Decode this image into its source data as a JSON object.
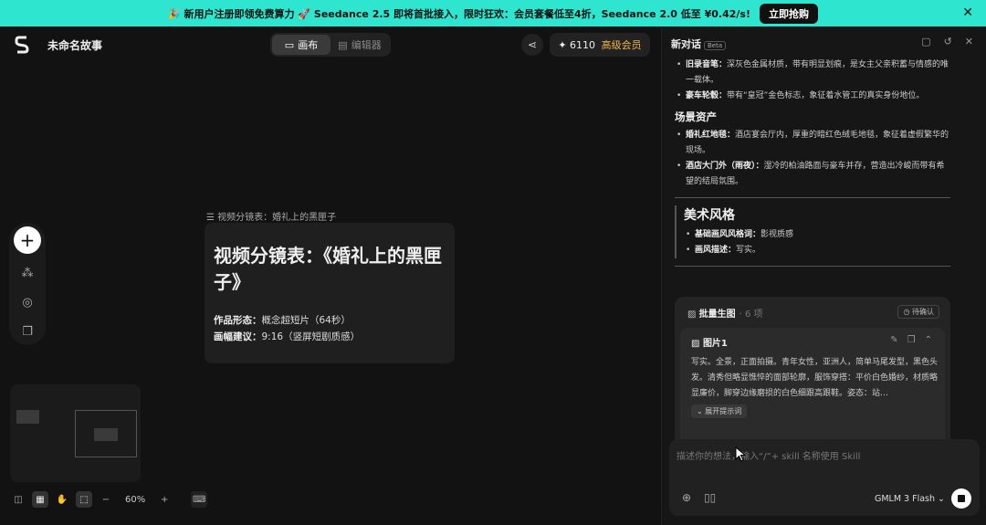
{
  "banner": {
    "text": "🎉 新用户注册即领免费算力 🚀 Seedance 2.5 即将首批接入，限时狂欢：会员套餐低至4折，Seedance 2.0 低至 ¥0.42/s!",
    "cta": "立即抢购",
    "close_icon": "close-icon"
  },
  "header": {
    "project_title": "未命名故事",
    "tabs": [
      {
        "label": "画布",
        "active": true
      },
      {
        "label": "编辑器",
        "active": false
      }
    ],
    "credits": "6110",
    "vip_label": "高级会员"
  },
  "canvas": {
    "node_title": "视频分镜表：婚礼上的黑匣子",
    "card_heading": "视频分镜表：《婚礼上的黑匣子》",
    "line1_label": "作品形态：",
    "line1_value": "概念超短片（64秒）",
    "line2_label": "画幅建议：",
    "line2_value": "9:16（竖屏短剧质感）",
    "zoom": "60%"
  },
  "panel": {
    "title": "新对话",
    "badge": "Beta",
    "items_top": [
      {
        "label": "旧录音笔：",
        "text": "深灰色金属材质，带有明显划痕，是女主父亲积蓄与情感的唯一载体。"
      },
      {
        "label": "豪车轮毂：",
        "text": "带有“皇冠”金色标志，象征着水管工的真实身份地位。"
      }
    ],
    "scene_heading": "场景资产",
    "scene_items": [
      {
        "label": "婚礼红地毯：",
        "text": "酒店宴会厅内，厚重的暗红色绒毛地毯，象征着虚假繁华的现场。"
      },
      {
        "label": "酒店大门外（雨夜）：",
        "text": "湿冷的柏油路面与豪车并存，营造出冷峻而带有希望的结局氛围。"
      }
    ],
    "art_heading": "美术风格",
    "art_items": [
      {
        "label": "基础画风风格词：",
        "text": "影视质感"
      },
      {
        "label": "画风描述：",
        "text": "写实。"
      }
    ],
    "batch": {
      "title": "批量生图",
      "count": "· 6 项",
      "status": "待确认",
      "image_title": "图片1",
      "image_desc": "写实。全景，正面拍摄。青年女性，亚洲人，简单马尾发型，黑色头发。清秀但略显憔悴的面部轮廓，服饰穿搭：平价白色婚纱，材质略显廉价，脚穿边缘磨损的白色细跟高跟鞋。姿态：站…",
      "expand": "展开提示词"
    },
    "input_placeholder": "描述你的想法，输入“/”+ skill 名称使用 Skill",
    "model": "GMLM 3 Flash"
  }
}
